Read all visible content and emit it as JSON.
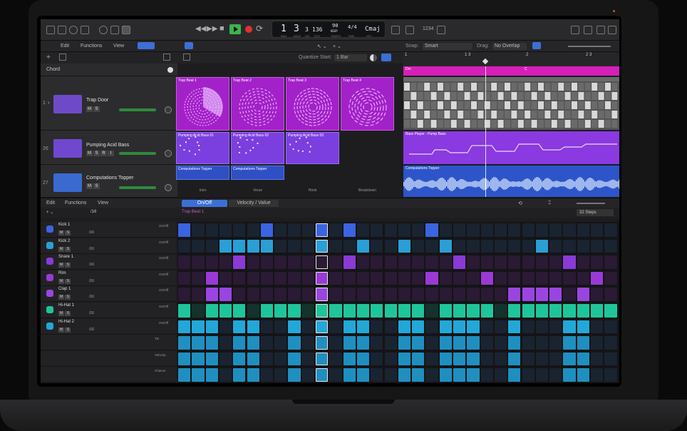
{
  "toolbar": {
    "menu_edit": "Edit",
    "menu_functions": "Functions",
    "menu_view": "View",
    "lcd_bar": "1",
    "lcd_beat": "3",
    "lcd_div": "3",
    "lcd_tick": "136",
    "lcd_tempo": "90",
    "lcd_keep": "KEEP",
    "lcd_sig": "4/4",
    "lcd_key": "Cmaj",
    "lcd_lbl_bar": "BAR",
    "lcd_lbl_beat": "BEAT",
    "lcd_lbl_div": "DIV",
    "lcd_lbl_tick": "TICK",
    "lcd_lbl_tempo": "TEMPO",
    "lcd_lbl_time": "TIME",
    "lcd_lbl_key": "KEY",
    "count_in": "1234",
    "snap_label": "Snap:",
    "snap_value": "Smart",
    "drag_label": "Drag:",
    "drag_value": "No Overlap",
    "quantize_label": "Quantize Start:",
    "quantize_value": "1 Bar"
  },
  "chord_track": {
    "label": "Chord"
  },
  "tracks": [
    {
      "num": "1",
      "name": "Trap Door",
      "ms": [
        "M",
        "S"
      ]
    },
    {
      "num": "26",
      "name": "Pumping Acid Bass",
      "ms": [
        "M",
        "S",
        "R",
        "I"
      ]
    },
    {
      "num": "27",
      "name": "Computations Topper",
      "ms": [
        "M",
        "S"
      ]
    }
  ],
  "live_loops": {
    "row1": [
      "Trap Beat 1",
      "Trap Beat 2",
      "Trap Beat 3",
      "Trap Beat 4"
    ],
    "row2": [
      "Pumping Acid Bass 01",
      "Pumping Acid Bass 02",
      "Pumping Acid Bass 03"
    ],
    "row3": [
      "Computations Topper",
      "Computations Topper"
    ],
    "scenes": [
      "Intro",
      "Verse",
      "Hook",
      "Breakdown"
    ]
  },
  "timeline": {
    "ruler": [
      "1",
      "1 3",
      "2",
      "2 3"
    ],
    "chord_regions": [
      "Dm",
      "C"
    ],
    "regions": [
      "Trap Beat",
      "Bass Player - Pump Bass",
      "Computations Topper"
    ]
  },
  "step_sequencer": {
    "menu_edit": "Edit",
    "menu_functions": "Functions",
    "menu_view": "View",
    "tab_onoff": "On/Off",
    "tab_velocity": "Velocity / Value",
    "pattern_name": "Trap Beat 1",
    "steps_value": "32 Steps",
    "step_rate": "/16",
    "rows": [
      {
        "name": "Kick 1",
        "mode": "On/Off",
        "color": "#3a64e0"
      },
      {
        "name": "Kick 2",
        "mode": "On/Off",
        "color": "#2a9fd6"
      },
      {
        "name": "Snare 1",
        "mode": "On/Off",
        "color": "#8a3ad6"
      },
      {
        "name": "Rim",
        "mode": "On/Off",
        "color": "#9a3ad6"
      },
      {
        "name": "Clap 1",
        "mode": "On/Off",
        "color": "#9b45e0"
      },
      {
        "name": "Hi-Hat 1",
        "mode": "On/Off",
        "color": "#1fc59a"
      },
      {
        "name": "Hi-Hat 2",
        "mode": "On/Off",
        "color": "#22a8d8"
      }
    ],
    "sub_rows": [
      "Tie",
      "Velocity",
      "Chance"
    ]
  }
}
